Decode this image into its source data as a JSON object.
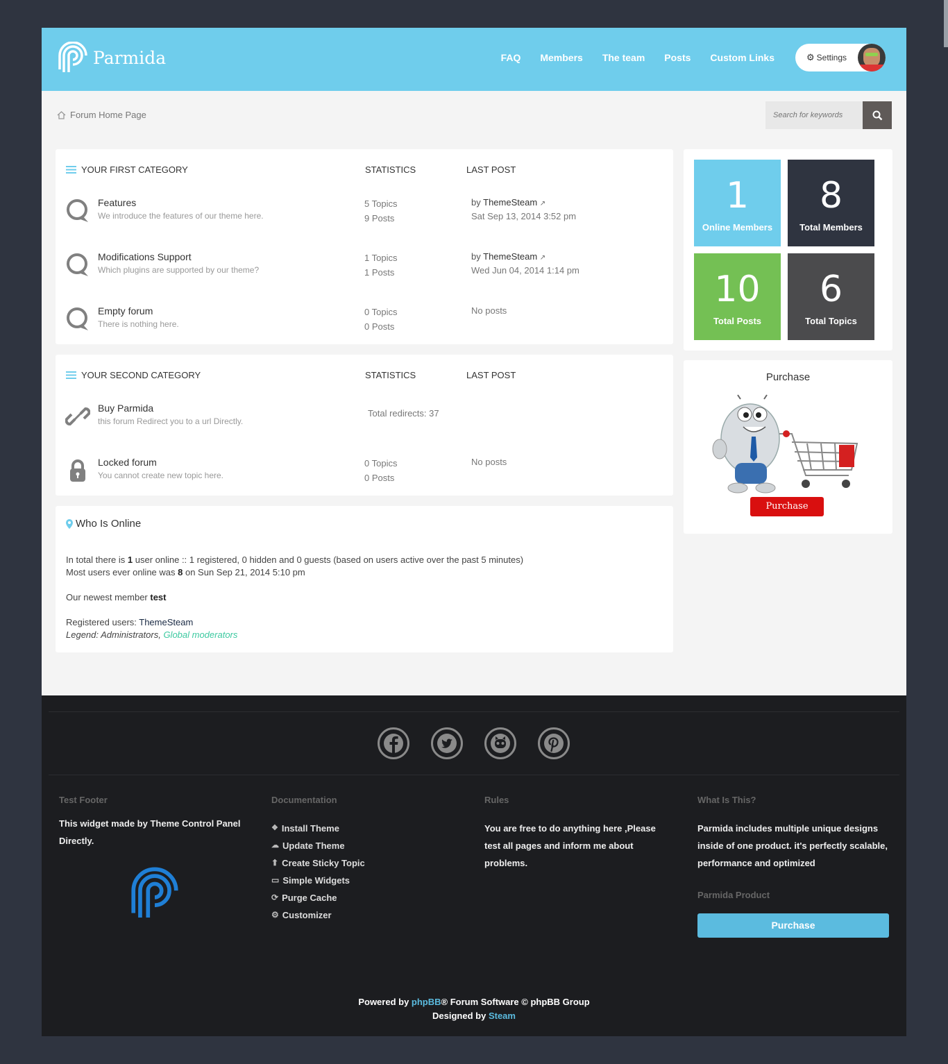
{
  "header": {
    "brand": "Parmida",
    "nav": [
      "FAQ",
      "Members",
      "The team",
      "Posts",
      "Custom Links"
    ],
    "settings_label": "Settings"
  },
  "breadcrumb": {
    "label": "Forum Home Page"
  },
  "search": {
    "placeholder": "Search for keywords"
  },
  "categories": [
    {
      "name": "YOUR FIRST CATEGORY",
      "stat_header": "STATISTICS",
      "last_header": "LAST POST",
      "forums": [
        {
          "title": "Features",
          "desc": "We introduce the features of our theme here.",
          "topics": "5 Topics",
          "posts": "9 Posts",
          "by": "by",
          "author": "ThemeSteam",
          "date": "Sat Sep 13, 2014 3:52 pm"
        },
        {
          "title": "Modifications Support",
          "desc": "Which plugins are supported by our theme?",
          "topics": "1 Topics",
          "posts": "1 Posts",
          "by": "by",
          "author": "ThemeSteam",
          "date": "Wed Jun 04, 2014 1:14 pm"
        },
        {
          "title": "Empty forum",
          "desc": "There is nothing here.",
          "topics": "0 Topics",
          "posts": "0 Posts",
          "last": "No posts"
        }
      ]
    },
    {
      "name": "YOUR SECOND CATEGORY",
      "stat_header": "STATISTICS",
      "last_header": "LAST POST",
      "forums": [
        {
          "title": "Buy Parmida",
          "desc": "this forum Redirect you to a url Directly.",
          "redirects": "Total redirects: 37"
        },
        {
          "title": "Locked forum",
          "desc": "You cannot create new topic here.",
          "topics": "0 Topics",
          "posts": "0 Posts",
          "last": "No posts"
        }
      ]
    }
  ],
  "stats": [
    {
      "num": "1",
      "label": "Online Members",
      "color": "#6fcdec"
    },
    {
      "num": "8",
      "label": "Total Members",
      "color": "#2f3440"
    },
    {
      "num": "10",
      "label": "Total Posts",
      "color": "#74c054"
    },
    {
      "num": "6",
      "label": "Total Topics",
      "color": "#4b4b4d"
    }
  ],
  "purchase_widget": {
    "title": "Purchase",
    "button": "Purchase"
  },
  "who_online": {
    "title": "Who Is Online",
    "l1a": "In total there is ",
    "l1b": "1",
    "l1c": " user online :: 1 registered, 0 hidden and 0 guests (based on users active over the past 5 minutes)",
    "l2a": "Most users ever online was ",
    "l2b": "8",
    "l2c": " on Sun Sep 21, 2014 5:10 pm",
    "l3a": "Our newest member ",
    "l3b": "test",
    "l4a": "Registered users: ",
    "l4b": "ThemeSteam",
    "l5a": "Legend: Administrators, ",
    "l5b": "Global moderators"
  },
  "footer": {
    "social": [
      "facebook-icon",
      "twitter-icon",
      "github-icon",
      "pinterest-icon"
    ],
    "col1": {
      "title": "Test Footer",
      "text": "This widget made by Theme Control Panel Directly."
    },
    "col2": {
      "title": "Documentation",
      "links": [
        "Install Theme",
        "Update Theme",
        "Create Sticky Topic",
        "Simple Widgets",
        "Purge Cache",
        "Customizer"
      ]
    },
    "col3": {
      "title": "Rules",
      "text": "You are free to do anything here ,Please test all pages and inform me about problems."
    },
    "col4": {
      "title": "What Is This?",
      "text": "Parmida includes multiple unique designs inside of one product. it's perfectly scalable, performance and optimized",
      "sub": "Parmida Product",
      "button": "Purchase"
    },
    "powered_a": "Powered by ",
    "powered_b": "phpBB",
    "powered_c": "® Forum Software © phpBB Group",
    "designed_a": "Designed by ",
    "designed_b": "Steam"
  },
  "colors": {
    "accent": "#6fcdec",
    "green": "#74c054",
    "dark": "#2f3440",
    "red": "#d90f0f"
  }
}
